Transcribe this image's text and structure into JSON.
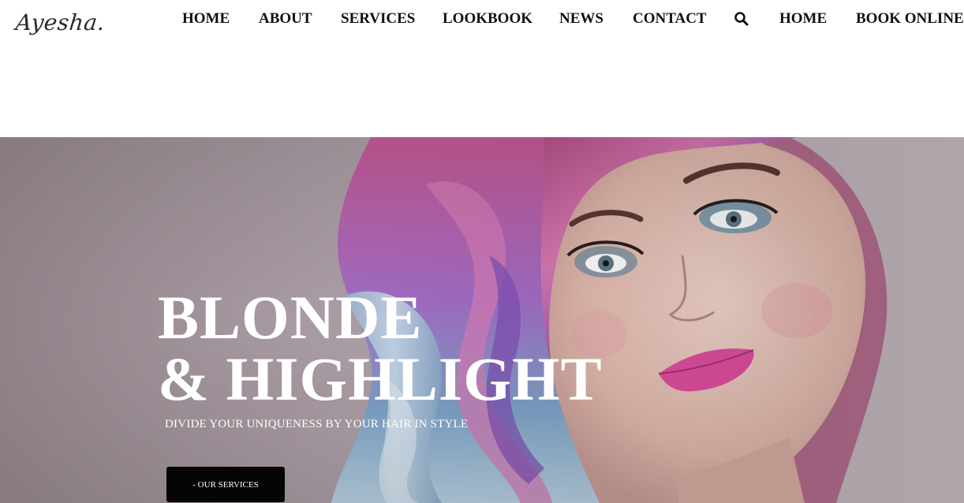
{
  "brand": {
    "logo_text": "Ayesha."
  },
  "nav": {
    "items": [
      {
        "label": "HOME"
      },
      {
        "label": "ABOUT"
      },
      {
        "label": "SERVICES"
      },
      {
        "label": "LOOKBOOK"
      },
      {
        "label": "NEWS"
      },
      {
        "label": "CONTACT"
      }
    ],
    "search_icon": "search-icon",
    "home_label": "HOME",
    "book_label": "BOOK ONLINE"
  },
  "hero": {
    "title_line1": "BLONDE",
    "title_line2": "& HIGHLIGHT",
    "subtitle": "DIVIDE YOUR UNIQUENESS BY YOUR HAIR IN STYLE",
    "cta_label": "- OUR SERVICES",
    "image_subject": "woman-with-pastel-pink-blue-hair"
  },
  "colors": {
    "hero_bg": "#a89aa2",
    "cta_bg": "#050505",
    "nav_text": "#111111",
    "hero_text": "#ffffff"
  }
}
